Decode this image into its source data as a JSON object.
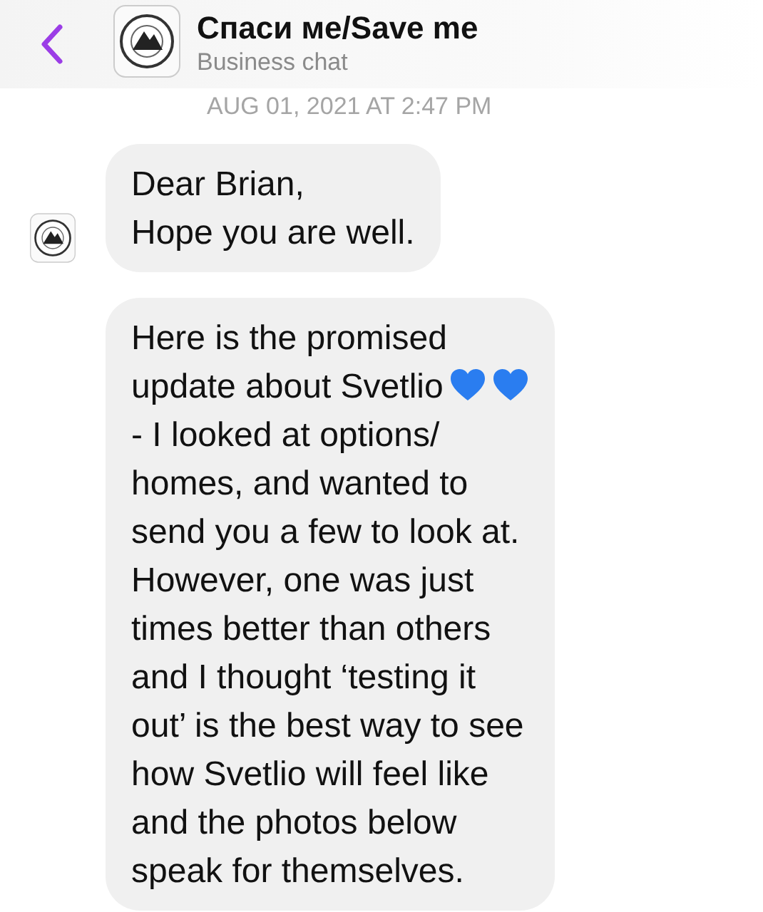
{
  "header": {
    "title": "Спаси ме/Save me",
    "subtitle": "Business chat"
  },
  "timestamp": "AUG 01, 2021 AT 2:47 PM",
  "messages": [
    {
      "lines": [
        "Dear Brian,",
        "Hope you are well."
      ],
      "avatar": true
    },
    {
      "lines": [
        "Here is the promised",
        "- I looked at options/",
        "homes, and wanted to",
        "send you a few to look at.",
        "However, one was just",
        "times better than others",
        "and I thought ‘testing it",
        "out’ is the best way to see",
        "how Svetlio will feel like",
        "and the photos below",
        "speak for themselves."
      ],
      "first_line_tail": "update about Svetlio",
      "avatar": false,
      "trailing_icons": [
        {
          "kind": "blue-heart"
        },
        {
          "kind": "blue-heart"
        }
      ]
    }
  ]
}
